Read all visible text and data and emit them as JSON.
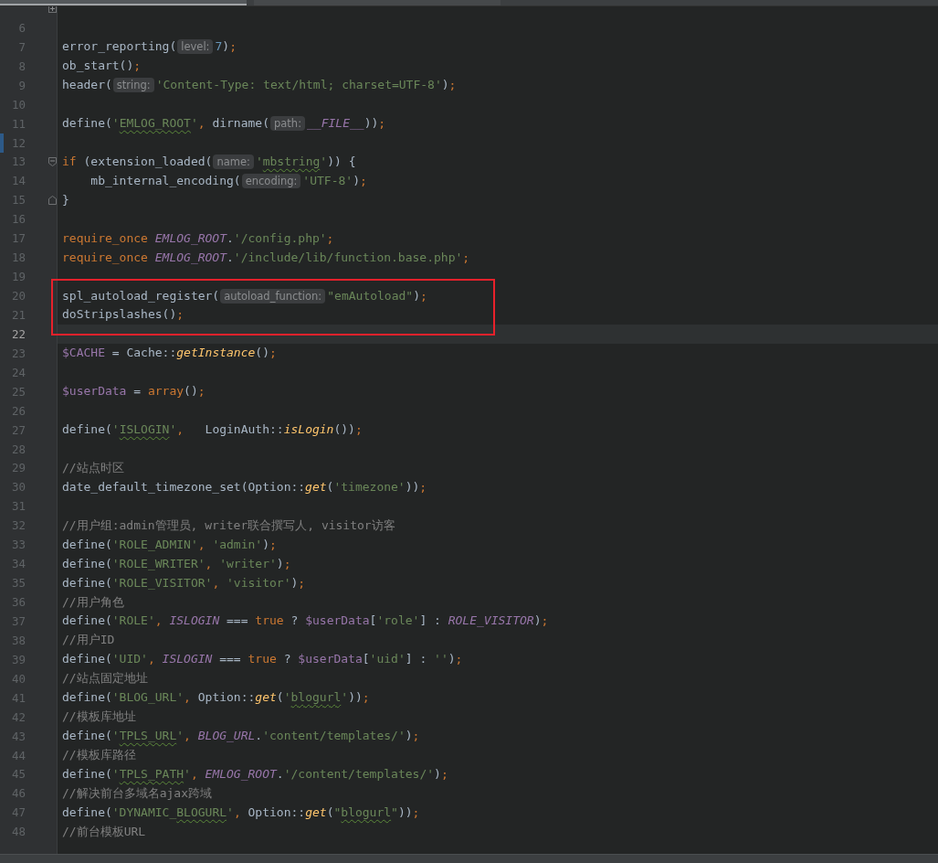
{
  "tabs": [
    {
      "selected": true
    },
    {
      "selected": false
    }
  ],
  "lines": [
    {
      "fold": {
        "kind": "closed"
      },
      "current": false,
      "marked": false
    },
    {
      "number": "6",
      "current": false,
      "marked": false
    },
    {
      "number": "7",
      "current": false,
      "marked": false,
      "tokens": [
        {
          "kind": "p",
          "text": "error_reporting("
        },
        {
          "kind": "hint",
          "text": "level:"
        },
        {
          "kind": "num",
          "text": "7"
        },
        {
          "kind": "p",
          "text": ")"
        },
        {
          "kind": "kw",
          "text": ";"
        }
      ]
    },
    {
      "number": "8",
      "current": false,
      "marked": false,
      "tokens": [
        {
          "kind": "p",
          "text": "ob_start()"
        },
        {
          "kind": "kw",
          "text": ";"
        }
      ]
    },
    {
      "number": "9",
      "current": false,
      "marked": false,
      "tokens": [
        {
          "kind": "p",
          "text": "header("
        },
        {
          "kind": "hint",
          "text": "string:"
        },
        {
          "kind": "str",
          "text": "'Content-Type: text/html; charset=UTF-8'"
        },
        {
          "kind": "p",
          "text": ")"
        },
        {
          "kind": "kw",
          "text": ";"
        }
      ]
    },
    {
      "number": "10",
      "current": false,
      "marked": false
    },
    {
      "number": "11",
      "current": false,
      "marked": false,
      "tokens": [
        {
          "kind": "p",
          "text": "define("
        },
        {
          "kind": "str",
          "text": "'"
        },
        {
          "kind": "typo",
          "text": "EMLOG_ROOT"
        },
        {
          "kind": "str",
          "text": "'"
        },
        {
          "kind": "kw",
          "text": ", "
        },
        {
          "kind": "p",
          "text": "dirname("
        },
        {
          "kind": "hint",
          "text": "path:"
        },
        {
          "kind": "const",
          "text": "__FILE__"
        },
        {
          "kind": "p",
          "text": "))"
        },
        {
          "kind": "kw",
          "text": ";"
        }
      ]
    },
    {
      "number": "12",
      "current": false,
      "marked": true
    },
    {
      "number": "13",
      "fold": {
        "kind": "open"
      },
      "current": false,
      "marked": false,
      "tokens": [
        {
          "kind": "kw",
          "text": "if "
        },
        {
          "kind": "p",
          "text": "(extension_loaded("
        },
        {
          "kind": "hint",
          "text": "name:"
        },
        {
          "kind": "str",
          "text": "'"
        },
        {
          "kind": "typo",
          "text": "mbstring"
        },
        {
          "kind": "str",
          "text": "'"
        },
        {
          "kind": "p",
          "text": ")) {"
        }
      ]
    },
    {
      "number": "14",
      "current": false,
      "marked": false,
      "tokens": [
        {
          "kind": "p",
          "text": "    mb_internal_encoding("
        },
        {
          "kind": "hint",
          "text": "encoding:"
        },
        {
          "kind": "str",
          "text": "'UTF-8'"
        },
        {
          "kind": "p",
          "text": ")"
        },
        {
          "kind": "kw",
          "text": ";"
        }
      ]
    },
    {
      "number": "15",
      "fold": {
        "kind": "end"
      },
      "current": false,
      "marked": false,
      "tokens": [
        {
          "kind": "p",
          "text": "}"
        }
      ]
    },
    {
      "number": "16",
      "current": false,
      "marked": false
    },
    {
      "number": "17",
      "current": false,
      "marked": false,
      "tokens": [
        {
          "kind": "kw",
          "text": "require_once "
        },
        {
          "kind": "const",
          "text": "EMLOG_ROOT"
        },
        {
          "kind": "p",
          "text": "."
        },
        {
          "kind": "str",
          "text": "'/config.php'"
        },
        {
          "kind": "kw",
          "text": ";"
        }
      ]
    },
    {
      "number": "18",
      "current": false,
      "marked": false,
      "tokens": [
        {
          "kind": "kw",
          "text": "require_once "
        },
        {
          "kind": "const",
          "text": "EMLOG_ROOT"
        },
        {
          "kind": "p",
          "text": "."
        },
        {
          "kind": "str",
          "text": "'/include/lib/function.base.php'"
        },
        {
          "kind": "kw",
          "text": ";"
        }
      ]
    },
    {
      "number": "19",
      "current": false,
      "marked": false
    },
    {
      "number": "20",
      "current": false,
      "marked": false,
      "tokens": [
        {
          "kind": "p",
          "text": "spl_autoload_register("
        },
        {
          "kind": "hint",
          "text": "autoload_function:"
        },
        {
          "kind": "str",
          "text": "\"emAutoload\""
        },
        {
          "kind": "p",
          "text": ")"
        },
        {
          "kind": "kw",
          "text": ";"
        }
      ]
    },
    {
      "number": "21",
      "current": false,
      "marked": false,
      "tokens": [
        {
          "kind": "p",
          "text": "doStripslashes()"
        },
        {
          "kind": "kw",
          "text": ";"
        }
      ]
    },
    {
      "number": "22",
      "current": true,
      "marked": false
    },
    {
      "number": "23",
      "current": false,
      "marked": false,
      "tokens": [
        {
          "kind": "var",
          "text": "$CACHE"
        },
        {
          "kind": "p",
          "text": " = Cache::"
        },
        {
          "kind": "call",
          "text": "getInstance"
        },
        {
          "kind": "p",
          "text": "()"
        },
        {
          "kind": "kw",
          "text": ";"
        }
      ]
    },
    {
      "number": "24",
      "current": false,
      "marked": false
    },
    {
      "number": "25",
      "current": false,
      "marked": false,
      "tokens": [
        {
          "kind": "var",
          "text": "$userData"
        },
        {
          "kind": "p",
          "text": " = "
        },
        {
          "kind": "kw",
          "text": "array"
        },
        {
          "kind": "p",
          "text": "()"
        },
        {
          "kind": "kw",
          "text": ";"
        }
      ]
    },
    {
      "number": "26",
      "current": false,
      "marked": false
    },
    {
      "number": "27",
      "current": false,
      "marked": false,
      "tokens": [
        {
          "kind": "p",
          "text": "define("
        },
        {
          "kind": "str",
          "text": "'"
        },
        {
          "kind": "typo",
          "text": "ISLOGIN"
        },
        {
          "kind": "str",
          "text": "'"
        },
        {
          "kind": "kw",
          "text": ",   "
        },
        {
          "kind": "p",
          "text": "LoginAuth::"
        },
        {
          "kind": "call",
          "text": "isLogin"
        },
        {
          "kind": "p",
          "text": "())"
        },
        {
          "kind": "kw",
          "text": ";"
        }
      ]
    },
    {
      "number": "28",
      "current": false,
      "marked": false
    },
    {
      "number": "29",
      "current": false,
      "marked": false,
      "tokens": [
        {
          "kind": "cm",
          "text": "//站点时区"
        }
      ]
    },
    {
      "number": "30",
      "current": false,
      "marked": false,
      "tokens": [
        {
          "kind": "p",
          "text": "date_default_timezone_set(Option::"
        },
        {
          "kind": "call",
          "text": "get"
        },
        {
          "kind": "p",
          "text": "("
        },
        {
          "kind": "str",
          "text": "'timezone'"
        },
        {
          "kind": "p",
          "text": "))"
        },
        {
          "kind": "kw",
          "text": ";"
        }
      ]
    },
    {
      "number": "31",
      "current": false,
      "marked": false
    },
    {
      "number": "32",
      "current": false,
      "marked": false,
      "tokens": [
        {
          "kind": "cm",
          "text": "//用户组:admin管理员, writer联合撰写人, visitor访客"
        }
      ]
    },
    {
      "number": "33",
      "current": false,
      "marked": false,
      "tokens": [
        {
          "kind": "p",
          "text": "define("
        },
        {
          "kind": "str",
          "text": "'ROLE_ADMIN'"
        },
        {
          "kind": "kw",
          "text": ", "
        },
        {
          "kind": "str",
          "text": "'admin'"
        },
        {
          "kind": "p",
          "text": ")"
        },
        {
          "kind": "kw",
          "text": ";"
        }
      ]
    },
    {
      "number": "34",
      "current": false,
      "marked": false,
      "tokens": [
        {
          "kind": "p",
          "text": "define("
        },
        {
          "kind": "str",
          "text": "'ROLE_WRITER'"
        },
        {
          "kind": "kw",
          "text": ", "
        },
        {
          "kind": "str",
          "text": "'writer'"
        },
        {
          "kind": "p",
          "text": ")"
        },
        {
          "kind": "kw",
          "text": ";"
        }
      ]
    },
    {
      "number": "35",
      "current": false,
      "marked": false,
      "tokens": [
        {
          "kind": "p",
          "text": "define("
        },
        {
          "kind": "str",
          "text": "'ROLE_VISITOR'"
        },
        {
          "kind": "kw",
          "text": ", "
        },
        {
          "kind": "str",
          "text": "'visitor'"
        },
        {
          "kind": "p",
          "text": ")"
        },
        {
          "kind": "kw",
          "text": ";"
        }
      ]
    },
    {
      "number": "36",
      "current": false,
      "marked": false,
      "tokens": [
        {
          "kind": "cm",
          "text": "//用户角色"
        }
      ]
    },
    {
      "number": "37",
      "current": false,
      "marked": false,
      "tokens": [
        {
          "kind": "p",
          "text": "define("
        },
        {
          "kind": "str",
          "text": "'ROLE'"
        },
        {
          "kind": "kw",
          "text": ", "
        },
        {
          "kind": "const",
          "text": "ISLOGIN"
        },
        {
          "kind": "p",
          "text": " === "
        },
        {
          "kind": "kw",
          "text": "true"
        },
        {
          "kind": "p",
          "text": " ? "
        },
        {
          "kind": "var",
          "text": "$userData"
        },
        {
          "kind": "p",
          "text": "["
        },
        {
          "kind": "str",
          "text": "'role'"
        },
        {
          "kind": "p",
          "text": "] : "
        },
        {
          "kind": "const",
          "text": "ROLE_VISITOR"
        },
        {
          "kind": "p",
          "text": ")"
        },
        {
          "kind": "kw",
          "text": ";"
        }
      ]
    },
    {
      "number": "38",
      "current": false,
      "marked": false,
      "tokens": [
        {
          "kind": "cm",
          "text": "//用户ID"
        }
      ]
    },
    {
      "number": "39",
      "current": false,
      "marked": false,
      "tokens": [
        {
          "kind": "p",
          "text": "define("
        },
        {
          "kind": "str",
          "text": "'UID'"
        },
        {
          "kind": "kw",
          "text": ", "
        },
        {
          "kind": "const",
          "text": "ISLOGIN"
        },
        {
          "kind": "p",
          "text": " === "
        },
        {
          "kind": "kw",
          "text": "true"
        },
        {
          "kind": "p",
          "text": " ? "
        },
        {
          "kind": "var",
          "text": "$userData"
        },
        {
          "kind": "p",
          "text": "["
        },
        {
          "kind": "str",
          "text": "'uid'"
        },
        {
          "kind": "p",
          "text": "] : "
        },
        {
          "kind": "str",
          "text": "''"
        },
        {
          "kind": "p",
          "text": ")"
        },
        {
          "kind": "kw",
          "text": ";"
        }
      ]
    },
    {
      "number": "40",
      "current": false,
      "marked": false,
      "tokens": [
        {
          "kind": "cm",
          "text": "//站点固定地址"
        }
      ]
    },
    {
      "number": "41",
      "current": false,
      "marked": false,
      "tokens": [
        {
          "kind": "p",
          "text": "define("
        },
        {
          "kind": "str",
          "text": "'BLOG_URL'"
        },
        {
          "kind": "kw",
          "text": ", "
        },
        {
          "kind": "p",
          "text": "Option::"
        },
        {
          "kind": "call",
          "text": "get"
        },
        {
          "kind": "p",
          "text": "("
        },
        {
          "kind": "str",
          "text": "'"
        },
        {
          "kind": "typo",
          "text": "blogurl"
        },
        {
          "kind": "str",
          "text": "'"
        },
        {
          "kind": "p",
          "text": "))"
        },
        {
          "kind": "kw",
          "text": ";"
        }
      ]
    },
    {
      "number": "42",
      "current": false,
      "marked": false,
      "tokens": [
        {
          "kind": "cm",
          "text": "//模板库地址"
        }
      ]
    },
    {
      "number": "43",
      "current": false,
      "marked": false,
      "tokens": [
        {
          "kind": "p",
          "text": "define("
        },
        {
          "kind": "str",
          "text": "'"
        },
        {
          "kind": "typo",
          "text": "TPLS_URL"
        },
        {
          "kind": "str",
          "text": "'"
        },
        {
          "kind": "kw",
          "text": ", "
        },
        {
          "kind": "const",
          "text": "BLOG_URL"
        },
        {
          "kind": "p",
          "text": "."
        },
        {
          "kind": "str",
          "text": "'content/templates/'"
        },
        {
          "kind": "p",
          "text": ")"
        },
        {
          "kind": "kw",
          "text": ";"
        }
      ]
    },
    {
      "number": "44",
      "current": false,
      "marked": false,
      "tokens": [
        {
          "kind": "cm",
          "text": "//模板库路径"
        }
      ]
    },
    {
      "number": "45",
      "current": false,
      "marked": false,
      "tokens": [
        {
          "kind": "p",
          "text": "define("
        },
        {
          "kind": "str",
          "text": "'"
        },
        {
          "kind": "typo",
          "text": "TPLS_PATH"
        },
        {
          "kind": "str",
          "text": "'"
        },
        {
          "kind": "kw",
          "text": ", "
        },
        {
          "kind": "const",
          "text": "EMLOG_ROOT"
        },
        {
          "kind": "p",
          "text": "."
        },
        {
          "kind": "str",
          "text": "'/content/templates/'"
        },
        {
          "kind": "p",
          "text": ")"
        },
        {
          "kind": "kw",
          "text": ";"
        }
      ]
    },
    {
      "number": "46",
      "current": false,
      "marked": false,
      "tokens": [
        {
          "kind": "cm",
          "text": "//解决前台多域名ajax跨域"
        }
      ]
    },
    {
      "number": "47",
      "current": false,
      "marked": false,
      "tokens": [
        {
          "kind": "p",
          "text": "define("
        },
        {
          "kind": "str",
          "text": "'DYNAMIC_"
        },
        {
          "kind": "typo",
          "text": "BLOGURL"
        },
        {
          "kind": "str",
          "text": "'"
        },
        {
          "kind": "kw",
          "text": ", "
        },
        {
          "kind": "p",
          "text": "Option::"
        },
        {
          "kind": "call",
          "text": "get"
        },
        {
          "kind": "p",
          "text": "("
        },
        {
          "kind": "str",
          "text": "\""
        },
        {
          "kind": "typo",
          "text": "blogurl"
        },
        {
          "kind": "str",
          "text": "\""
        },
        {
          "kind": "p",
          "text": "))"
        },
        {
          "kind": "kw",
          "text": ";"
        }
      ]
    },
    {
      "number": "48",
      "current": false,
      "marked": false,
      "tokens": [
        {
          "kind": "cm",
          "text": "//前台模板URL"
        }
      ]
    }
  ]
}
